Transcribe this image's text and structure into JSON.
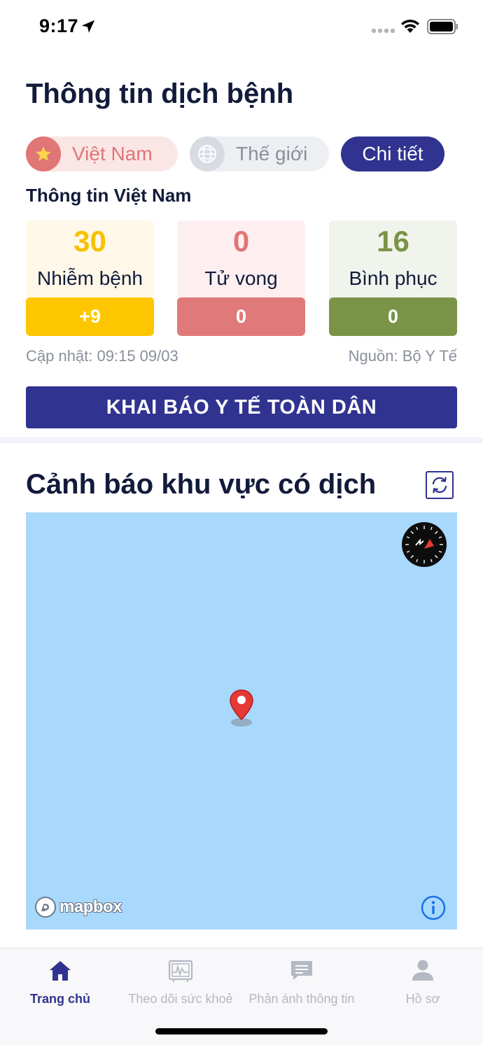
{
  "status_bar": {
    "time": "9:17"
  },
  "header": {
    "title": "Thông tin dịch bệnh"
  },
  "region_tabs": {
    "vietnam": "Việt Nam",
    "world": "Thế giới",
    "detail": "Chi tiết"
  },
  "section": {
    "subtitle": "Thông tin Việt Nam"
  },
  "stats": {
    "infected": {
      "value": "30",
      "label": "Nhiễm bệnh",
      "delta": "+9"
    },
    "deaths": {
      "value": "0",
      "label": "Tử vong",
      "delta": "0"
    },
    "recovered": {
      "value": "16",
      "label": "Bình phục",
      "delta": "0"
    }
  },
  "meta": {
    "updated": "Cập nhật: 09:15 09/03",
    "source": "Nguồn: Bộ Y Tế"
  },
  "declare_button": "KHAI BÁO Y TẾ TOÀN DÂN",
  "map_section": {
    "title": "Cảnh báo khu vực có dịch",
    "attribution": "mapbox"
  },
  "bottom_nav": {
    "items": [
      {
        "label": "Trang chủ",
        "icon": "home-icon",
        "active": true
      },
      {
        "label": "Theo dõi sức khoẻ",
        "icon": "monitor-icon",
        "active": false
      },
      {
        "label": "Phản ánh thông tin",
        "icon": "chat-icon",
        "active": false
      },
      {
        "label": "Hồ sơ",
        "icon": "person-icon",
        "active": false
      }
    ]
  },
  "colors": {
    "primary": "#30338f",
    "infected": "#fdc600",
    "deaths": "#e07a7a",
    "recovered": "#7a9447",
    "map_water": "#a9d8fd"
  }
}
